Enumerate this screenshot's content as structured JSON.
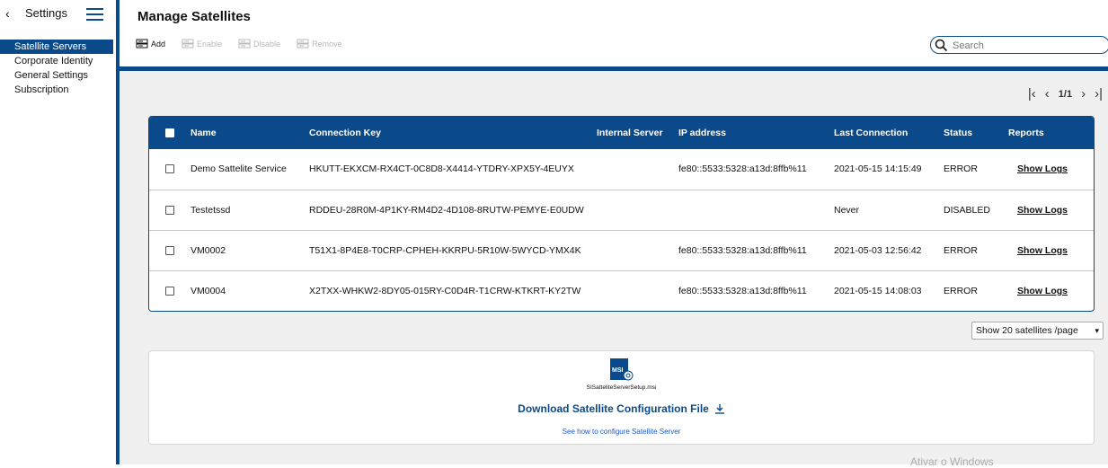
{
  "sidebar": {
    "title": "Settings",
    "items": [
      {
        "label": "Satellite Servers",
        "active": true
      },
      {
        "label": "Corporate Identity",
        "active": false
      },
      {
        "label": "General Settings",
        "active": false
      },
      {
        "label": "Subscription",
        "active": false
      }
    ]
  },
  "header": {
    "title": "Manage Satellites",
    "toolbar": {
      "add": "Add",
      "enable": "Enable",
      "disable": "Disable",
      "remove": "Remove"
    },
    "search_placeholder": "Search"
  },
  "pager": {
    "page": "1/1"
  },
  "table": {
    "columns": [
      "Name",
      "Connection Key",
      "Internal Server",
      "IP address",
      "Last Connection",
      "Status",
      "Reports"
    ],
    "rows": [
      {
        "name": "Demo Sattelite Service",
        "key": "HKUTT-EKXCM-RX4CT-0C8D8-X4414-YTDRY-XPX5Y-4EUYX",
        "internal": "",
        "ip": "fe80::5533:5328:a13d:8ffb%11",
        "last": "2021-05-15 14:15:49",
        "status": "ERROR",
        "report": "Show Logs"
      },
      {
        "name": "Testetssd",
        "key": "RDDEU-28R0M-4P1KY-RM4D2-4D108-8RUTW-PEMYE-E0UDW",
        "internal": "",
        "ip": "",
        "last": "Never",
        "status": "DISABLED",
        "report": "Show Logs"
      },
      {
        "name": "VM0002",
        "key": "T51X1-8P4E8-T0CRP-CPHEH-KKRPU-5R10W-5WYCD-YMX4K",
        "internal": "",
        "ip": "fe80::5533:5328:a13d:8ffb%11",
        "last": "2021-05-03 12:56:42",
        "status": "ERROR",
        "report": "Show Logs"
      },
      {
        "name": "VM0004",
        "key": "X2TXX-WHKW2-8DY05-015RY-C0D4R-T1CRW-KTKRT-KY2TW",
        "internal": "",
        "ip": "fe80::5533:5328:a13d:8ffb%11",
        "last": "2021-05-15 14:08:03",
        "status": "ERROR",
        "report": "Show Logs"
      }
    ]
  },
  "per_page": "Show 20 satellites /page",
  "download": {
    "file_name": "SISatteliteServerSetup.msi",
    "icon_label": "MSI",
    "title": "Download Satellite Configuration File",
    "help_link": "See how to configure Satellite Server"
  },
  "watermark": "Ativar o Windows",
  "colors": {
    "accent": "#0b4a8a",
    "link": "#1a56c8"
  }
}
